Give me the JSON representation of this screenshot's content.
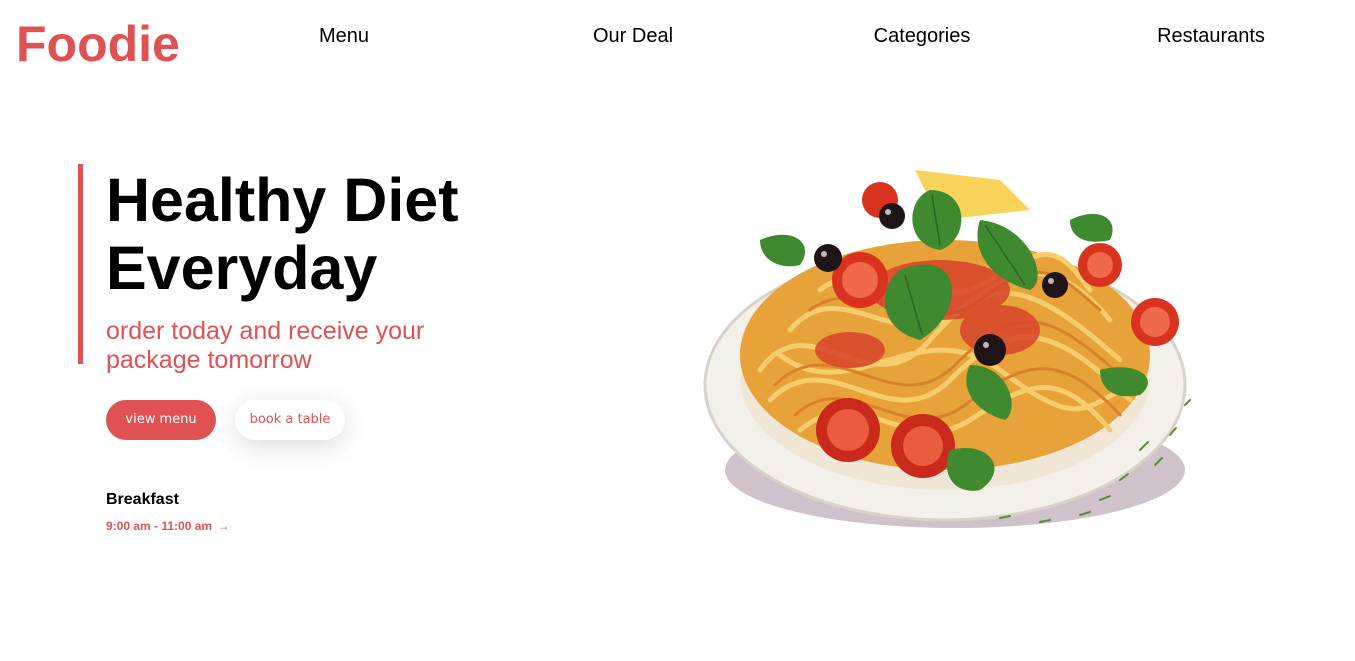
{
  "brand": {
    "logo": "Foodie",
    "accent": "#e05252"
  },
  "nav": {
    "items": [
      {
        "label": "Menu"
      },
      {
        "label": "Our Deal"
      },
      {
        "label": "Categories"
      },
      {
        "label": "Restaurants"
      }
    ]
  },
  "hero": {
    "title_line1": "Healthy Diet",
    "title_line2": "Everyday",
    "subtitle": "order today and receive your package tomorrow",
    "primary_button": "view menu",
    "secondary_button": "book a table"
  },
  "meal": {
    "name": "Breakfast",
    "hours": "9:00 am - 11:00 am",
    "arrow": "→"
  },
  "image": {
    "subject": "pasta-plate-illustration"
  }
}
